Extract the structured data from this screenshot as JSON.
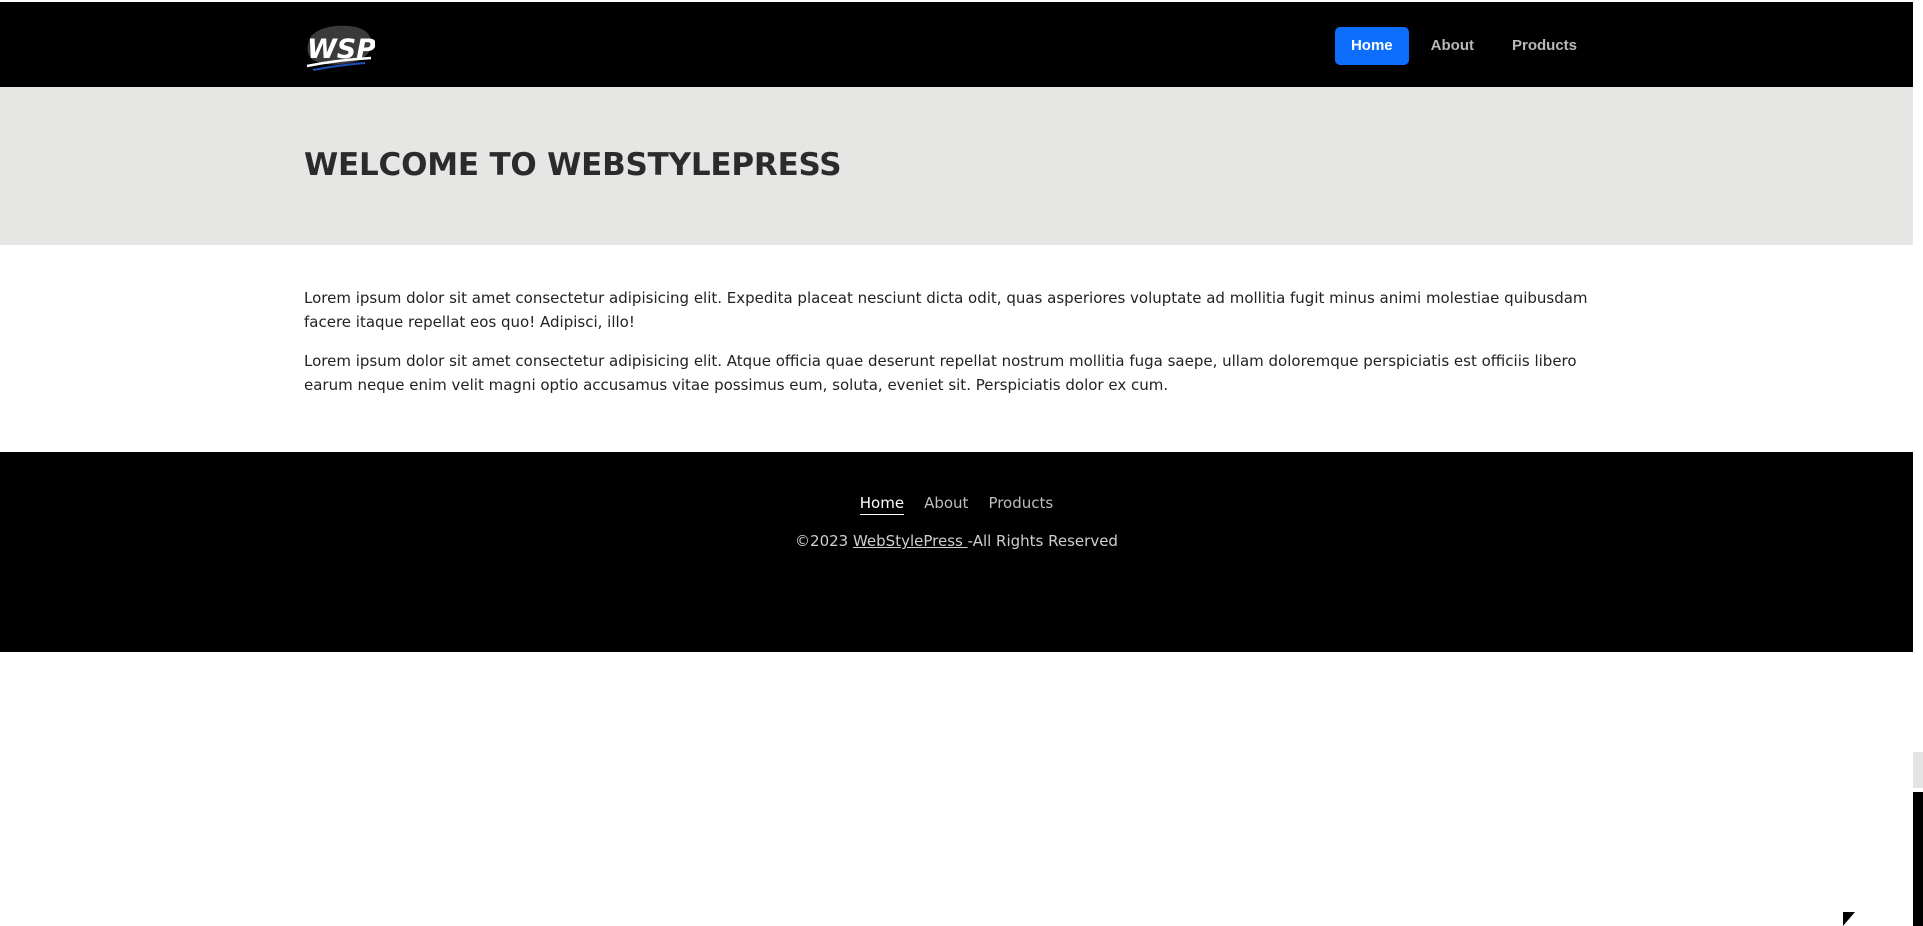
{
  "navbar": {
    "logo_text": "WSP",
    "links": [
      {
        "label": "Home",
        "active": true
      },
      {
        "label": "About",
        "active": false
      },
      {
        "label": "Products",
        "active": false
      }
    ]
  },
  "hero": {
    "title": "WELCOME TO WEBSTYLEPRESS"
  },
  "content": {
    "paragraphs": [
      "Lorem ipsum dolor sit amet consectetur adipisicing elit. Expedita placeat nesciunt dicta odit, quas asperiores voluptate ad mollitia fugit minus animi molestiae quibusdam facere itaque repellat eos quo! Adipisci, illo!",
      "Lorem ipsum dolor sit amet consectetur adipisicing elit. Atque officia quae deserunt repellat nostrum mollitia fuga saepe, ullam doloremque perspiciatis est officiis libero earum neque enim velit magni optio accusamus vitae possimus eum, soluta, eveniet sit. Perspiciatis dolor ex cum."
    ]
  },
  "footer": {
    "links": [
      {
        "label": "Home",
        "active": true
      },
      {
        "label": "About",
        "active": false
      },
      {
        "label": "Products",
        "active": false
      }
    ],
    "copyright_prefix": "©2023 ",
    "copyright_link": "WebStylePress ",
    "copyright_suffix": "-All Rights Reserved"
  },
  "colors": {
    "navbar_bg": "#000000",
    "accent": "#0d6efd",
    "hero_bg": "#e6e6e4",
    "footer_bg": "#000000"
  }
}
